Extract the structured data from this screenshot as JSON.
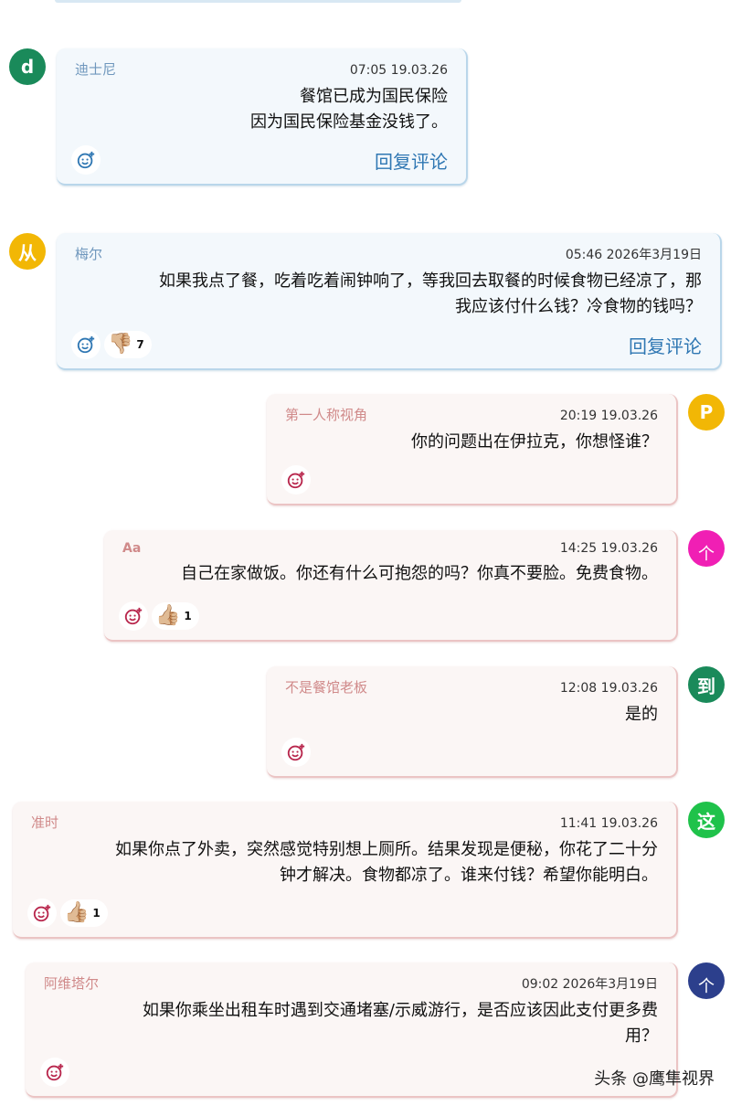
{
  "comments": [
    {
      "author": "迪士尼",
      "time": "07:05 19.03.26",
      "lines": [
        "餐馆已成为国民保险",
        "因为国民保险基金没钱了。"
      ],
      "reply": "回复评论",
      "avatar": "d",
      "avatar_color": "#1a8a5a"
    },
    {
      "author": "梅尔",
      "time": "05:46 2026年3月19日",
      "lines": [
        "如果我点了餐，吃着吃着闹钟响了，等我回去取餐的时候食物已经凉了，那",
        "我应该付什么钱？冷食物的钱吗？"
      ],
      "reaction": {
        "emoji": "👎🏼",
        "count": "7"
      },
      "reply": "回复评论",
      "avatar": "从",
      "avatar_color": "#f2b705"
    },
    {
      "author": "第一人称视角",
      "time": "20:19 19.03.26",
      "lines": [
        "你的问题出在伊拉克，你想怪谁？"
      ],
      "avatar": "P",
      "avatar_color": "#f2b705"
    },
    {
      "author": "Aa",
      "time": "14:25 19.03.26",
      "lines": [
        "自己在家做饭。你还有什么可抱怨的吗？你真不要脸。免费食物。"
      ],
      "reaction": {
        "emoji": "👍🏼",
        "count": "1"
      },
      "avatar": "个",
      "avatar_color": "#f01fb4"
    },
    {
      "author": "不是餐馆老板",
      "time": "12:08 19.03.26",
      "lines": [
        "是的"
      ],
      "avatar": "到",
      "avatar_color": "#1a8a5a"
    },
    {
      "author": "准时",
      "time": "11:41 19.03.26",
      "lines": [
        "如果你点了外卖，突然感觉特别想上厕所。结果发现是便秘，你花了二十分",
        "钟才解决。食物都凉了。谁来付钱？希望你能明白。"
      ],
      "reaction": {
        "emoji": "👍🏼",
        "count": "1"
      },
      "avatar": "这",
      "avatar_color": "#1fc24a"
    },
    {
      "author": "阿维塔尔",
      "time": "09:02 2026年3月19日",
      "lines": [
        "如果你乘坐出租车时遇到交通堵塞/示威游行，是否应该因此支付更多费",
        "用？"
      ],
      "avatar": "个",
      "avatar_color": "#2c3f8c"
    }
  ],
  "icons": {
    "add_reaction": "smiley-plus-icon"
  },
  "watermark": "头条 @鹰隼视界"
}
